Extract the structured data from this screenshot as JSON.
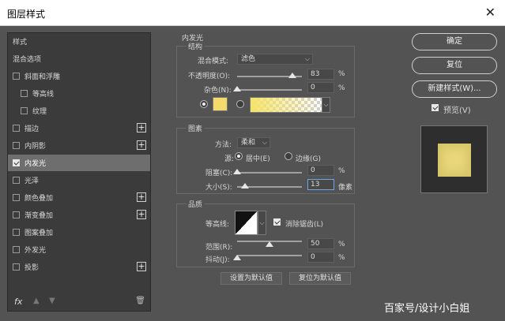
{
  "window": {
    "title": "图层样式",
    "close_icon": "close-icon"
  },
  "styles_panel": {
    "items": [
      {
        "label": "样式",
        "checkbox": false,
        "checked": false,
        "plus": false,
        "active": false
      },
      {
        "label": "混合选项",
        "checkbox": false,
        "checked": false,
        "plus": false,
        "active": false
      },
      {
        "label": "斜面和浮雕",
        "checkbox": true,
        "checked": false,
        "plus": false,
        "active": false
      },
      {
        "label": "等高线",
        "checkbox": true,
        "checked": false,
        "plus": false,
        "active": false,
        "indent": true
      },
      {
        "label": "纹理",
        "checkbox": true,
        "checked": false,
        "plus": false,
        "active": false,
        "indent": true
      },
      {
        "label": "描边",
        "checkbox": true,
        "checked": false,
        "plus": true,
        "active": false
      },
      {
        "label": "内阴影",
        "checkbox": true,
        "checked": false,
        "plus": true,
        "active": false
      },
      {
        "label": "内发光",
        "checkbox": true,
        "checked": true,
        "plus": false,
        "active": true
      },
      {
        "label": "光泽",
        "checkbox": true,
        "checked": false,
        "plus": false,
        "active": false
      },
      {
        "label": "颜色叠加",
        "checkbox": true,
        "checked": false,
        "plus": true,
        "active": false
      },
      {
        "label": "渐变叠加",
        "checkbox": true,
        "checked": false,
        "plus": true,
        "active": false
      },
      {
        "label": "图案叠加",
        "checkbox": true,
        "checked": false,
        "plus": false,
        "active": false
      },
      {
        "label": "外发光",
        "checkbox": true,
        "checked": false,
        "plus": false,
        "active": false
      },
      {
        "label": "投影",
        "checkbox": true,
        "checked": false,
        "plus": true,
        "active": false
      }
    ],
    "fx_label": "fx",
    "up_icon": "arrow-up-icon",
    "down_icon": "arrow-down-icon",
    "trash_icon": "trash-icon"
  },
  "inner_glow": {
    "section_title": "内发光",
    "structure": {
      "title": "结构",
      "blend_mode_label": "混合模式:",
      "blend_mode_value": "滤色",
      "opacity_label": "不透明度(O):",
      "opacity_value": "83",
      "opacity_unit": "%",
      "noise_label": "杂色(N):",
      "noise_value": "0",
      "noise_unit": "%",
      "color": "#f5d96a"
    },
    "elements": {
      "title": "图素",
      "method_label": "方法:",
      "method_value": "柔和",
      "source_label": "源:",
      "source_center": "居中(E)",
      "source_edge": "边缘(G)",
      "choke_label": "阻塞(C):",
      "choke_value": "0",
      "choke_unit": "%",
      "size_label": "大小(S):",
      "size_value": "13",
      "size_unit": "像素"
    },
    "quality": {
      "title": "品质",
      "contour_label": "等高线:",
      "antialias_label": "消除锯齿(L)",
      "range_label": "范围(R):",
      "range_value": "50",
      "range_unit": "%",
      "jitter_label": "抖动(J):",
      "jitter_value": "0",
      "jitter_unit": "%"
    },
    "set_default": "设置为默认值",
    "reset_default": "复位为默认值"
  },
  "right_panel": {
    "ok": "确定",
    "reset": "复位",
    "new_style": "新建样式(W)...",
    "preview_label": "预览(V)",
    "preview_checked": true
  },
  "watermark": "百家号/设计小白姐"
}
